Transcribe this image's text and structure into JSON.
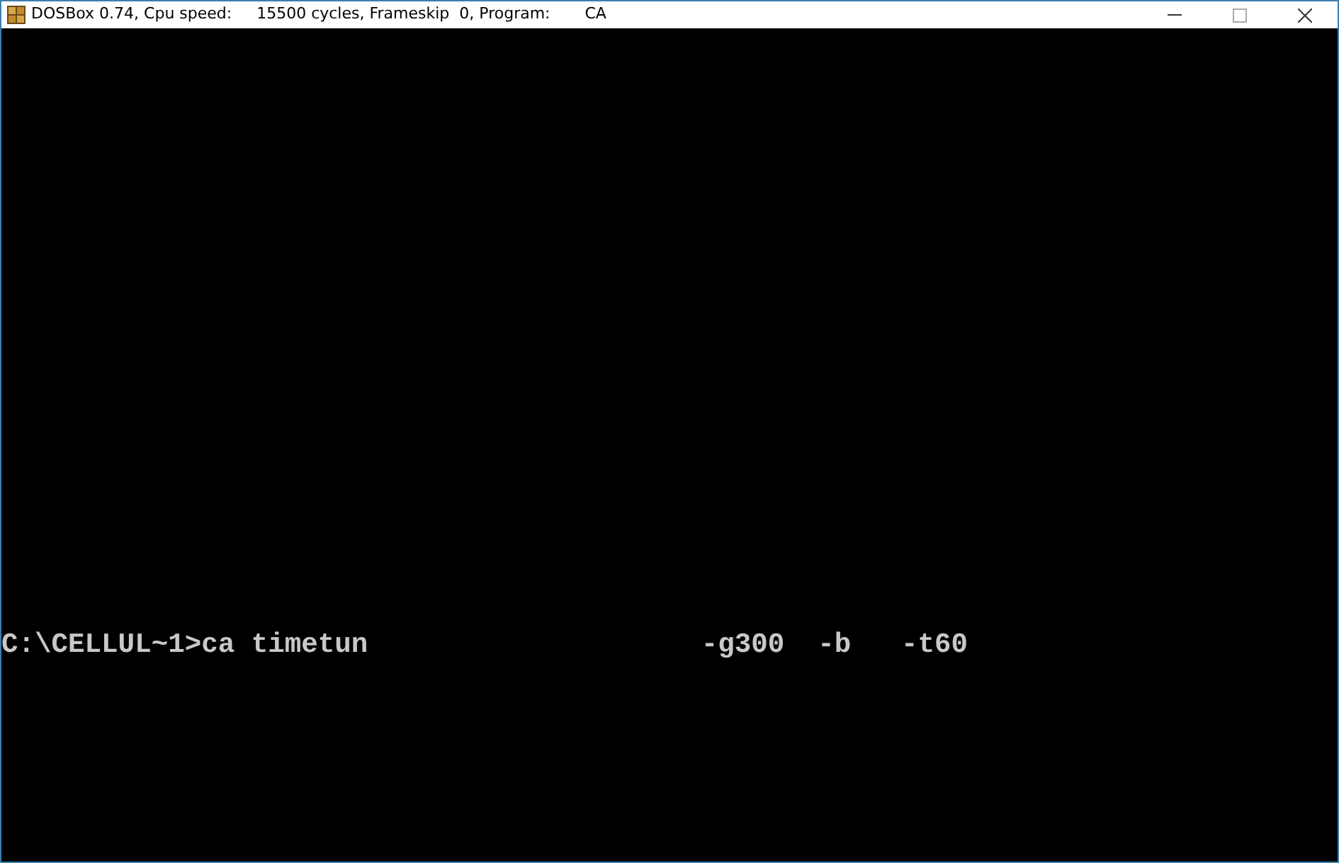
{
  "window": {
    "title": "DOSBox 0.74, Cpu speed:     15500 cycles, Frameskip  0, Program:       CA"
  },
  "console": {
    "lines": [
      "C:\\CELLUL~1>ca timetun                    -g300  -b   -t60"
    ]
  }
}
